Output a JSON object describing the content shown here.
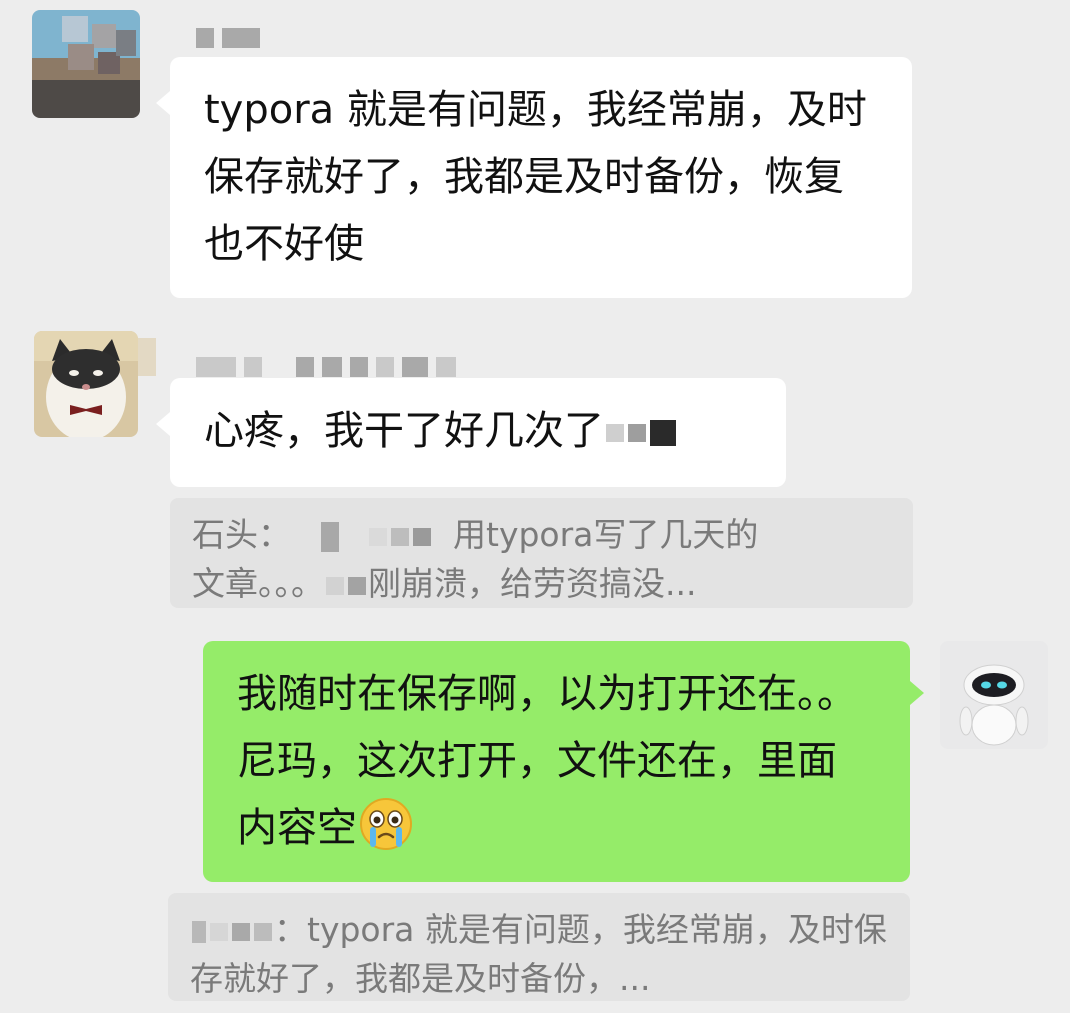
{
  "messages": [
    {
      "side": "left",
      "text": "typora 就是有问题，我经常崩，及时保存就好了，我都是及时备份，恢复也不好使"
    },
    {
      "side": "left",
      "text": "心疼，我干了好几次了"
    },
    {
      "quote_prefix": "石头：",
      "quote_text_a": "用typora写了几天的",
      "quote_text_b": "文章。。。",
      "quote_text_c": "刚崩溃，给劳资搞没..."
    },
    {
      "side": "right",
      "text": "我随时在保存啊，以为打开还在。。尼玛，这次打开，文件还在，里面内容空",
      "emoji": "crying-face"
    },
    {
      "quote_text": "：typora 就是有问题，我经常崩，及时保存就好了，我都是及时备份，..."
    }
  ],
  "colors": {
    "background": "#ededed",
    "left_bubble": "#ffffff",
    "right_bubble": "#95ec69",
    "quote_bg": "#e3e3e3",
    "quote_text": "#7a7a7a"
  }
}
